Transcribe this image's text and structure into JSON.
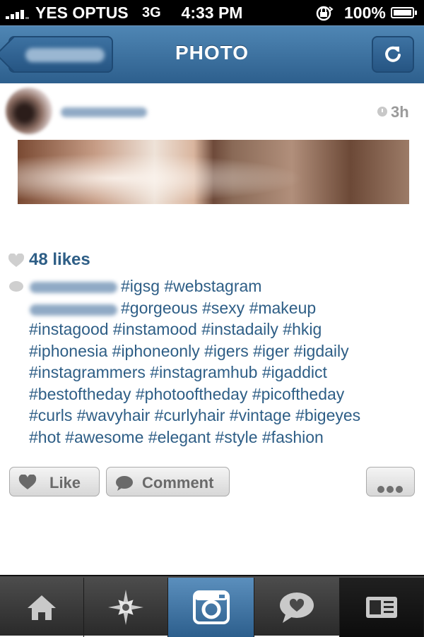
{
  "status_bar": {
    "carrier": "YES OPTUS",
    "network": "3G",
    "time": "4:33 PM",
    "battery": "100%",
    "battery_level": 1.0
  },
  "nav": {
    "title": "PHOTO",
    "back_icon": "chevron-left-icon",
    "refresh_icon": "refresh-icon"
  },
  "post": {
    "time_ago": "3h",
    "likes": "48 likes",
    "caption": [
      "#igsg #webstagram",
      "#gorgeous #sexy #makeup",
      "#instagood #instamood #instadaily #hkig",
      "#iphonesia #iphoneonly #igers #iger #igdaily",
      "#instagrammers #instagramhub #igaddict",
      "#bestoftheday #photooftheday #picoftheday",
      "#curls #wavyhair #curlyhair #vintage #bigeyes",
      "#hot #awesome #elegant #style #fashion"
    ]
  },
  "actions": {
    "like_label": "Like",
    "comment_label": "Comment"
  },
  "tabs": [
    {
      "name": "home",
      "icon": "home-icon"
    },
    {
      "name": "explore",
      "icon": "compass-star-icon"
    },
    {
      "name": "camera",
      "icon": "camera-icon",
      "active": true
    },
    {
      "name": "news",
      "icon": "speech-heart-icon"
    },
    {
      "name": "profile",
      "icon": "profile-card-icon"
    }
  ],
  "colors": {
    "nav_blue": "#2d5f8d",
    "link_blue": "#2e5e86",
    "tab_active": "#4a7fae"
  }
}
